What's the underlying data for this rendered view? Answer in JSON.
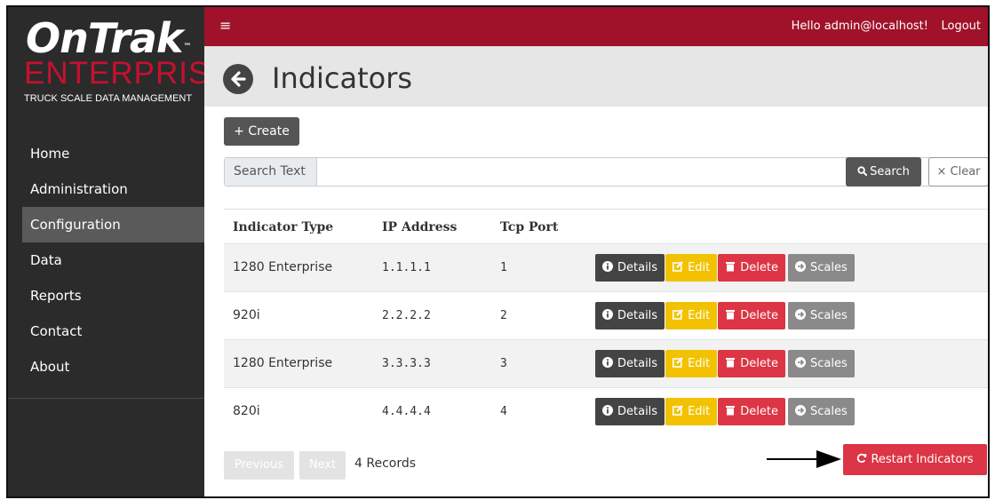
{
  "brand": {
    "name": "OnTrak",
    "tm": "™",
    "edition": "ENTERPRISE",
    "tagline": "TRUCK SCALE DATA MANAGEMENT",
    "accent_color": "#c8102e"
  },
  "topbar": {
    "menu_icon": "hamburger-icon",
    "greeting": "Hello admin@localhost!",
    "logout": "Logout",
    "color": "#a0122a"
  },
  "sidebar": {
    "items": [
      {
        "label": "Home",
        "active": false
      },
      {
        "label": "Administration",
        "active": false
      },
      {
        "label": "Configuration",
        "active": true
      },
      {
        "label": "Data",
        "active": false
      },
      {
        "label": "Reports",
        "active": false
      },
      {
        "label": "Contact",
        "active": false
      },
      {
        "label": "About",
        "active": false
      }
    ]
  },
  "page": {
    "back_icon": "arrow-left-circle-icon",
    "title": "Indicators"
  },
  "toolbar": {
    "create_label": "+ Create"
  },
  "search": {
    "label": "Search Text",
    "value": "",
    "search_label": "Search",
    "search_icon": "search-icon",
    "clear_label": "× Clear"
  },
  "table": {
    "columns": [
      "Indicator Type",
      "IP Address",
      "Tcp Port"
    ],
    "rows": [
      {
        "type": "1280 Enterprise",
        "ip": "1.1.1.1",
        "port": "1"
      },
      {
        "type": "920i",
        "ip": "2.2.2.2",
        "port": "2"
      },
      {
        "type": "1280 Enterprise",
        "ip": "3.3.3.3",
        "port": "3"
      },
      {
        "type": "820i",
        "ip": "4.4.4.4",
        "port": "4"
      }
    ],
    "actions": {
      "details": "Details",
      "edit": "Edit",
      "delete": "Delete",
      "scales": "Scales"
    }
  },
  "pager": {
    "previous": "Previous",
    "next": "Next",
    "records": "4 Records"
  },
  "restart": {
    "label": "Restart Indicators",
    "icon": "refresh-icon"
  },
  "colors": {
    "danger": "#dc3545",
    "warning": "#f2c200",
    "dark": "#444444",
    "secondary": "#8a8a8a"
  }
}
